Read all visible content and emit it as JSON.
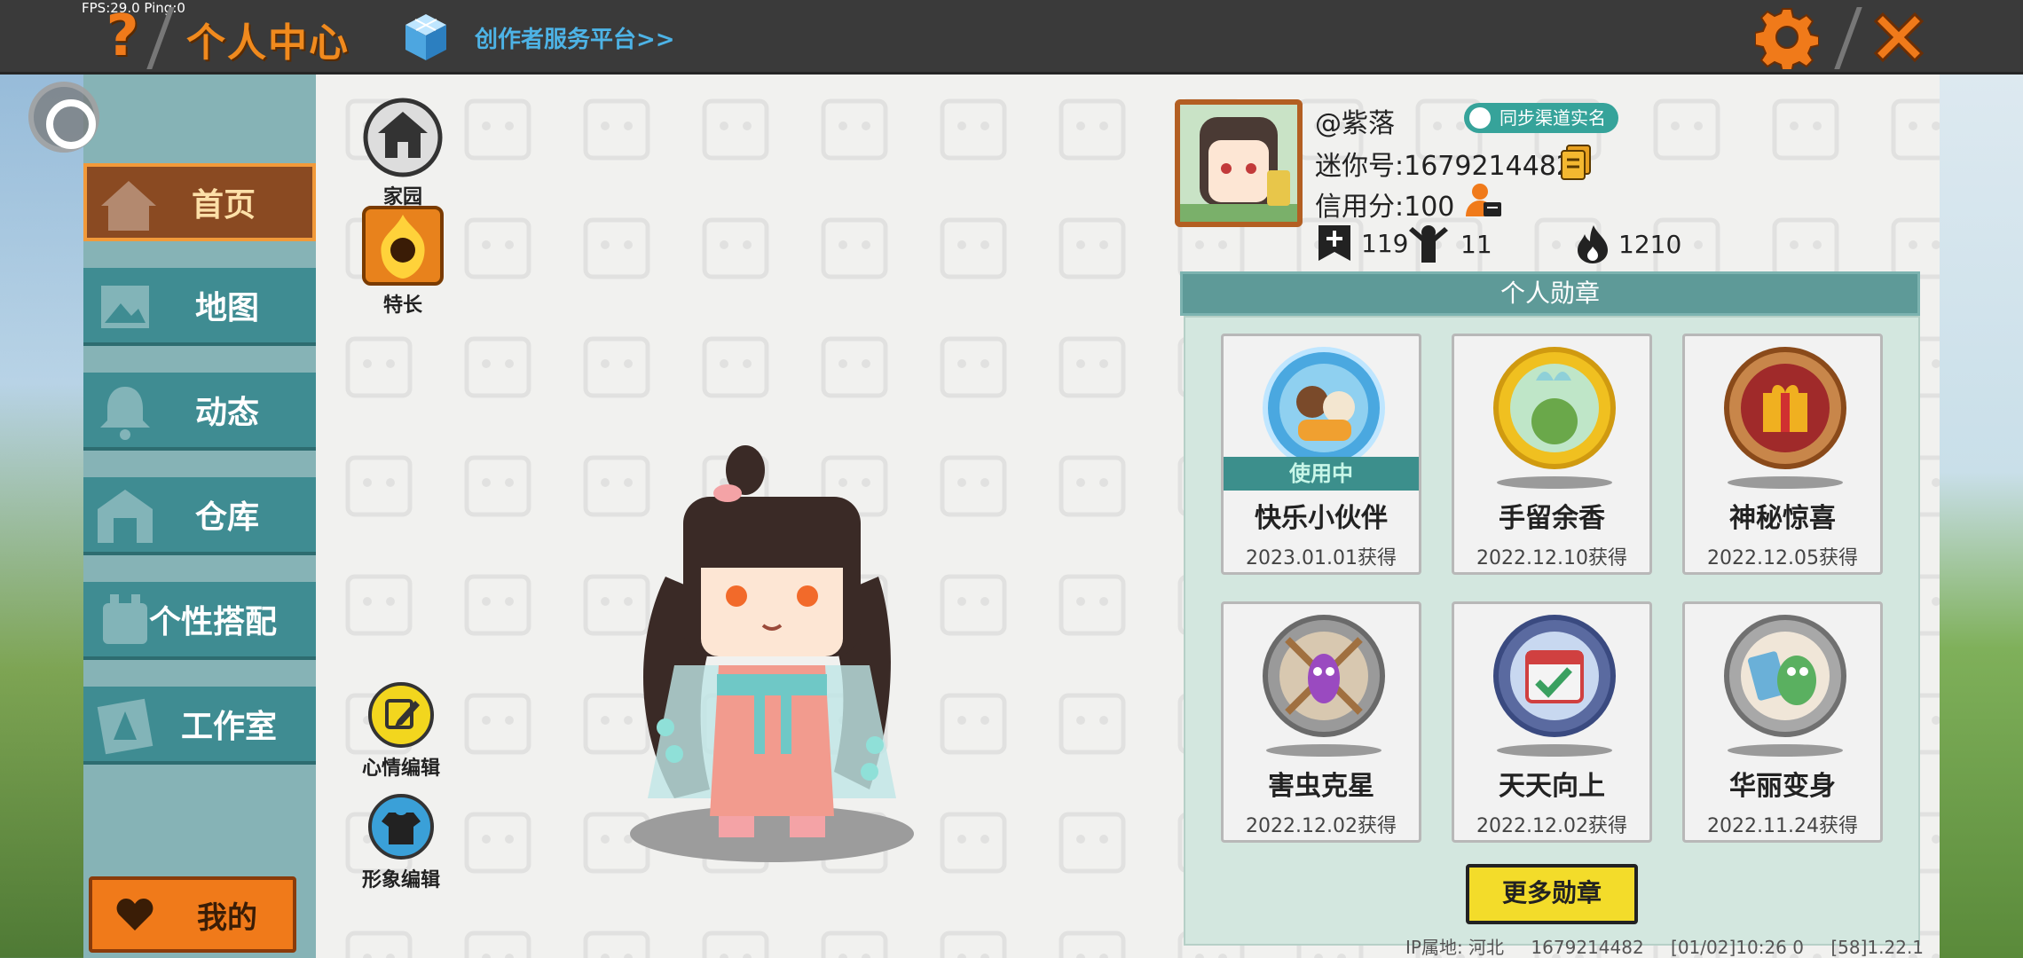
{
  "debug": {
    "fps_label": "FPS:29.0  Ping:0"
  },
  "header": {
    "title": "个人中心",
    "creator_link": "创作者服务平台>>",
    "accent": "#f08a1e"
  },
  "sidebar": {
    "items": [
      {
        "label": "首页",
        "active": true
      },
      {
        "label": "地图",
        "active": false
      },
      {
        "label": "动态",
        "active": false
      },
      {
        "label": "仓库",
        "active": false
      },
      {
        "label": "个性搭配",
        "active": false
      },
      {
        "label": "工作室",
        "active": false
      }
    ],
    "mine_label": "我的"
  },
  "shortcuts": {
    "home_label": "家园",
    "talent_label": "特长",
    "mood_edit_label": "心情编辑",
    "avatar_edit_label": "形象编辑"
  },
  "profile": {
    "nickname": "@紫落",
    "sync_badge": "同步渠道实名",
    "mini_id": "迷你号:1679214482",
    "credit": "信用分:100",
    "friends": "119",
    "fans": "11",
    "popularity": "1210"
  },
  "medals": {
    "header": "个人勋章",
    "in_use_label": "使用中",
    "items": [
      {
        "name": "快乐小伙伴",
        "date": "2023.01.01获得",
        "in_use": true,
        "icon": "happy-partner-medal-icon"
      },
      {
        "name": "手留余香",
        "date": "2022.12.10获得",
        "in_use": false,
        "icon": "lingering-fragrance-medal-icon"
      },
      {
        "name": "神秘惊喜",
        "date": "2022.12.05获得",
        "in_use": false,
        "icon": "mystery-gift-medal-icon"
      },
      {
        "name": "害虫克星",
        "date": "2022.12.02获得",
        "in_use": false,
        "icon": "pest-buster-medal-icon"
      },
      {
        "name": "天天向上",
        "date": "2022.12.02获得",
        "in_use": false,
        "icon": "daily-progress-medal-icon"
      },
      {
        "name": "华丽变身",
        "date": "2022.11.24获得",
        "in_use": false,
        "icon": "gorgeous-transform-medal-icon"
      }
    ],
    "more_label": "更多勋章"
  },
  "footer": {
    "ip_location": "IP属地: 河北",
    "uid": "1679214482",
    "time_info": "[01/02]10:26 0",
    "version": "[58]1.22.1"
  }
}
